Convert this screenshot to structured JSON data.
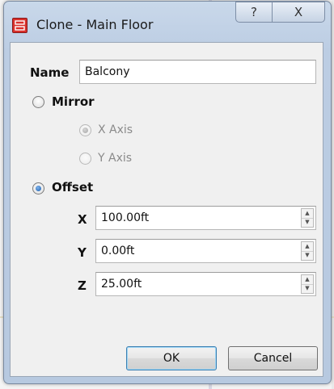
{
  "window": {
    "title": "Clone - Main Floor",
    "help_symbol": "?",
    "close_symbol": "X"
  },
  "form": {
    "name_label": "Name",
    "name_value": "Balcony",
    "mirror_label": "Mirror",
    "mirror_selected": false,
    "x_axis_label": "X Axis",
    "y_axis_label": "Y Axis",
    "offset_label": "Offset",
    "offset_selected": true,
    "x_label": "X",
    "x_value": "100.00ft",
    "y_label": "Y",
    "y_value": "0.00ft",
    "z_label": "Z",
    "z_value": "25.00ft"
  },
  "buttons": {
    "ok_label": "OK",
    "cancel_label": "Cancel"
  },
  "colors": {
    "title_bar": "#bccde3",
    "accent": "#1b5fb0",
    "app_icon": "#d9302b"
  },
  "icons": {
    "app": "app-icon",
    "help": "help-icon",
    "close": "close-icon",
    "spin_up": "spin-up-icon",
    "spin_down": "spin-down-icon"
  }
}
